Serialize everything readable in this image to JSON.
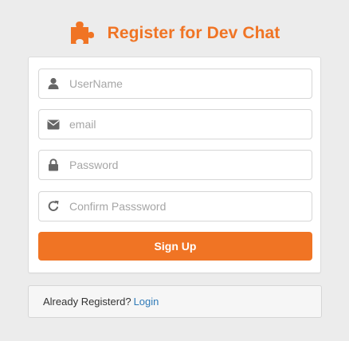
{
  "colors": {
    "accent": "#f07424",
    "link": "#2f7ab8",
    "icon": "#666666"
  },
  "header": {
    "logo_icon": "puzzle-icon",
    "title": "Register for Dev Chat"
  },
  "form": {
    "username": {
      "icon": "user-icon",
      "value": "",
      "placeholder": "UserName"
    },
    "email": {
      "icon": "envelope-icon",
      "value": "",
      "placeholder": "email"
    },
    "password": {
      "icon": "lock-icon",
      "value": "",
      "placeholder": "Password"
    },
    "confirm_password": {
      "icon": "refresh-icon",
      "value": "",
      "placeholder": "Confirm Passsword"
    },
    "submit_label": "Sign Up"
  },
  "footer": {
    "prompt": "Already Registerd?",
    "login_link": "Login"
  }
}
